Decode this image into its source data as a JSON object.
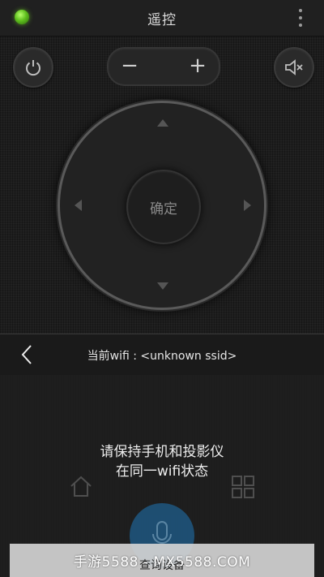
{
  "header": {
    "title": "遥控",
    "status_color": "#6ccf24"
  },
  "remote": {
    "volume_minus": "−",
    "volume_plus": "+",
    "ok_label": "确定",
    "power_icon": "power-icon",
    "mute_icon": "volume-mute-icon"
  },
  "panel": {
    "wifi_label": "当前wifi : <unknown ssid>",
    "message": "请保持手机和投影仪\n在同一wifi状态",
    "query_button": "查询设备",
    "accent_color": "#1f5f8e"
  },
  "watermark": "手游5588 - MX5588.COM"
}
